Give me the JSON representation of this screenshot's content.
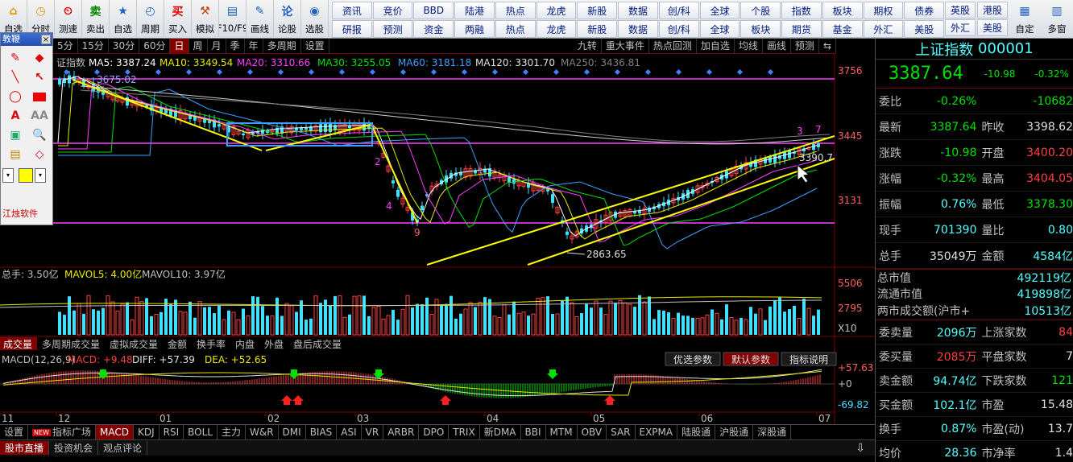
{
  "toolbar": {
    "buttons": [
      {
        "label": "自选",
        "icon": "home-icon"
      },
      {
        "label": "分时",
        "icon": "clock-icon"
      },
      {
        "label": "测速",
        "icon": "speed-icon"
      },
      {
        "label": "卖出",
        "icon": "sell-icon"
      },
      {
        "label": "自选",
        "icon": "star-icon"
      },
      {
        "label": "周期",
        "icon": "period-icon"
      },
      {
        "label": "买入",
        "icon": "buy-icon"
      },
      {
        "label": "模拟",
        "icon": "hammer-icon"
      },
      {
        "label": "F10/F9",
        "icon": "f10-icon"
      },
      {
        "label": "画线",
        "icon": "pen-icon"
      },
      {
        "label": "论股",
        "icon": "discuss-icon"
      },
      {
        "label": "选股",
        "icon": "select-stock-icon"
      }
    ],
    "grid": [
      "资讯",
      "竞价",
      "BBD",
      "陆港",
      "热点",
      "龙虎",
      "新股",
      "数据",
      "创/科",
      "全球",
      "个股",
      "指数",
      "板块",
      "期权",
      "债券",
      "研报",
      "预测",
      "资金",
      "两融",
      "热点",
      "龙虎",
      "新股",
      "数据",
      "创/科",
      "全球",
      "板块",
      "期货",
      "基金",
      "外汇",
      "美股"
    ],
    "extra": [
      {
        "label": "英股",
        "sub": "外汇"
      },
      {
        "label": "港股",
        "sub": "美股"
      },
      {
        "label": "自定",
        "icon": "custom-icon"
      },
      {
        "label": "多窗",
        "icon": "window-icon"
      }
    ]
  },
  "drawpanel": {
    "title": "教鞭",
    "brand": "江烛软件"
  },
  "periodbar": {
    "tabs": [
      "5分",
      "15分",
      "30分",
      "60分",
      "日",
      "周",
      "月",
      "季",
      "年",
      "多周期",
      "设置"
    ],
    "active": "日",
    "right": [
      "九转",
      "重大事件",
      "热点回测",
      "加自选",
      "均线",
      "画线",
      "预测"
    ]
  },
  "ma": {
    "label": "证指数",
    "items": [
      {
        "text": "MA5: 3387.24",
        "color": "#ffffff"
      },
      {
        "text": "MA10: 3349.54",
        "color": "#e8e800"
      },
      {
        "text": "MA20: 3310.66",
        "color": "#ff40ff"
      },
      {
        "text": "MA30: 3255.05",
        "color": "#00e000"
      },
      {
        "text": "MA60: 3181.18",
        "color": "#40a0ff"
      },
      {
        "text": "MA120: 3301.70",
        "color": "#e0e0e0"
      },
      {
        "text": "MA250: 3436.81",
        "color": "#808080"
      }
    ]
  },
  "price_axis": [
    "3756",
    "3445",
    "3131"
  ],
  "annotations": {
    "low": "2863.65",
    "high_left": "3675.02",
    "wave_low": "9",
    "wave_2": "2",
    "wave_4": "4",
    "wave_7": "7",
    "wave_3": "3",
    "right_val": "3390.7"
  },
  "volume": {
    "items": [
      {
        "text": "总手: 3.50亿",
        "color": "#c0c0c0"
      },
      {
        "text": "MAVOL5: 4.00亿",
        "color": "#e8e800"
      },
      {
        "text": "MAVOL10: 3.97亿",
        "color": "#c0c0c0"
      }
    ],
    "axis": [
      "5506",
      "2795",
      "X10"
    ]
  },
  "volume_tabs": [
    "成交量",
    "多周期成交量",
    "虚拟成交量",
    "金额",
    "换手率",
    "内盘",
    "外盘",
    "盘后成交量"
  ],
  "macd": {
    "label": "MACD(12,26,9)",
    "items": [
      {
        "text": "MACD: +9.48",
        "color": "#ff4040"
      },
      {
        "text": "DIFF: +57.39",
        "color": "#e0e0e0"
      },
      {
        "text": "DEA: +52.65",
        "color": "#e8e800"
      }
    ],
    "buttons": [
      "优选参数",
      "默认参数",
      "指标说明"
    ],
    "axis": [
      "+57.63",
      "+0",
      "-69.82"
    ]
  },
  "months": [
    "11",
    "12",
    "01",
    "02",
    "03",
    "04",
    "05",
    "06",
    "07"
  ],
  "bottomtabs": {
    "new_label": "NEW",
    "items": [
      "设置",
      "指标广场",
      "MACD",
      "KDJ",
      "RSI",
      "BOLL",
      "主力",
      "W&R",
      "DMI",
      "BIAS",
      "ASI",
      "VR",
      "ARBR",
      "DPO",
      "TRIX",
      "新DMA",
      "BBI",
      "MTM",
      "OBV",
      "SAR",
      "EXPMA",
      "陆股通",
      "沪股通",
      "深股通"
    ],
    "active": "MACD"
  },
  "newsbar": [
    "股市直播",
    "投资机会",
    "观点评论"
  ],
  "quote": {
    "name": "上证指数",
    "code": "000001",
    "price": "3387.64",
    "change": "-10.98",
    "pct": "-0.32%",
    "rows": [
      {
        "k": "委比",
        "v": "-0.26%",
        "vc": "g",
        "k2": "",
        "v2": "-10682",
        "v2c": "g"
      },
      {
        "k": "最新",
        "v": "3387.64",
        "vc": "g",
        "k2": "昨收",
        "v2": "3398.62",
        "v2c": "w"
      },
      {
        "k": "涨跌",
        "v": "-10.98",
        "vc": "g",
        "k2": "开盘",
        "v2": "3400.20",
        "v2c": "r"
      },
      {
        "k": "涨幅",
        "v": "-0.32%",
        "vc": "g",
        "k2": "最高",
        "v2": "3404.05",
        "v2c": "r"
      },
      {
        "k": "振幅",
        "v": "0.76%",
        "vc": "c",
        "k2": "最低",
        "v2": "3378.30",
        "v2c": "g"
      },
      {
        "k": "现手",
        "v": "701390",
        "vc": "c",
        "k2": "量比",
        "v2": "0.80",
        "v2c": "c"
      },
      {
        "k": "总手",
        "v": "35049万",
        "vc": "w",
        "k2": "金额",
        "v2": "4584亿",
        "v2c": "c"
      }
    ],
    "rows2": [
      {
        "k": "总市值",
        "v": "492119亿",
        "vc": "c"
      },
      {
        "k": "流通市值",
        "v": "419898亿",
        "vc": "c"
      },
      {
        "k": "两市成交额(沪市+深市)",
        "v": "10513亿",
        "vc": "c"
      }
    ],
    "rows3": [
      {
        "k": "委卖量",
        "v": "2096万",
        "vc": "c",
        "k2": "上涨家数",
        "v2": "84",
        "v2c": "r"
      },
      {
        "k": "委买量",
        "v": "2085万",
        "vc": "r",
        "k2": "平盘家数",
        "v2": "7",
        "v2c": "w"
      },
      {
        "k": "卖金额",
        "v": "94.74亿",
        "vc": "c",
        "k2": "下跌家数",
        "v2": "121",
        "v2c": "g"
      },
      {
        "k": "买金额",
        "v": "102.1亿",
        "vc": "c",
        "k2": "市盈",
        "v2": "15.48",
        "v2c": "w"
      },
      {
        "k": "换手",
        "v": "0.87%",
        "vc": "c",
        "k2": "市盈(动)",
        "v2": "13.7",
        "v2c": "w"
      },
      {
        "k": "均价",
        "v": "28.36",
        "vc": "c",
        "k2": "市净率",
        "v2": "1.4",
        "v2c": "w"
      }
    ]
  }
}
